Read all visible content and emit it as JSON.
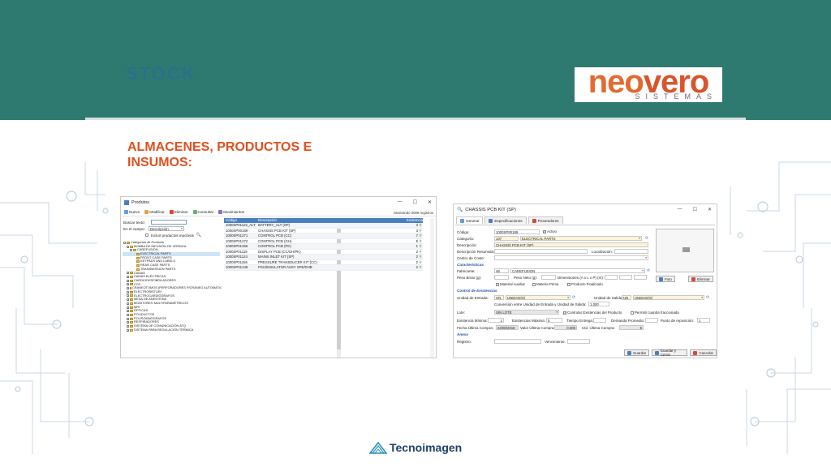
{
  "slide": {
    "title": "STOCK",
    "section_heading": "ALMACENES, PRODUCTOS E INSUMOS:",
    "logo": {
      "word_part1": "neo",
      "word_part2": "vero",
      "sub": "SISTEMAS"
    },
    "footer_logo": "Tecnoimagen",
    "colors": {
      "band": "#2f7a70",
      "heading": "#e0501f",
      "logo_orange": "#e36a2e"
    }
  },
  "products_window": {
    "title": "Produtos",
    "controls": {
      "minimize": "—",
      "maximize": "☐",
      "close": "✕"
    },
    "toolbar": [
      "Nuevo",
      "Modificar",
      "Eliminar",
      "Consultar",
      "Movimientos"
    ],
    "status": "Mostrando 0009 registros",
    "search": {
      "label": "Buscar texto:",
      "field_label": "En el campo:",
      "field_value": "Descripción",
      "include_inactive": "Incluir productos inactivos"
    },
    "tree": [
      {
        "label": "Categorías de Producto",
        "level": 0,
        "expander": "−"
      },
      {
        "label": "BOMBA DE INFUSIÓN DE JERINGA",
        "level": 1,
        "expander": "−"
      },
      {
        "label": "CAREFUSION",
        "level": 2,
        "expander": "−"
      },
      {
        "label": "ELECTRICAL PARTS",
        "level": 3,
        "expander": "",
        "selected": true
      },
      {
        "label": "FRONT CASE PARTS",
        "level": 3,
        "expander": ""
      },
      {
        "label": "KEYPADS AND LABELS",
        "level": 3,
        "expander": ""
      },
      {
        "label": "REAR CASE PARTS",
        "level": 3,
        "expander": ""
      },
      {
        "label": "TRANSMISSION PARTS",
        "level": 3,
        "expander": ""
      },
      {
        "label": "CAMAS",
        "level": 1,
        "expander": "+"
      },
      {
        "label": "CAMAS ELÉCTRICAS",
        "level": 1,
        "expander": "+"
      },
      {
        "label": "CARDIODESFIBRILADORES",
        "level": 1,
        "expander": "+"
      },
      {
        "label": "CO2",
        "level": 1,
        "expander": "+"
      },
      {
        "label": "CRANEOTOMOS (PERFORADORES P/CRÁNEO AUTOMÁTICOS)",
        "level": 1,
        "expander": "+"
      },
      {
        "label": "ELECTROBISTURI",
        "level": 1,
        "expander": "+"
      },
      {
        "label": "ELECTROCARDIÓGRAFOS",
        "level": 1,
        "expander": "+"
      },
      {
        "label": "MESA DE ANESTESIA",
        "level": 1,
        "expander": "+"
      },
      {
        "label": "MONITORES MULTIPARAMÉTRICOS",
        "level": 1,
        "expander": "+"
      },
      {
        "label": "MRI",
        "level": 1,
        "expander": "+"
      },
      {
        "label": "ÓPTICAS",
        "level": 1,
        "expander": "+"
      },
      {
        "label": "POLIDUCTOS",
        "level": 1,
        "expander": "+"
      },
      {
        "label": "POLISOMNÓGRAFOS",
        "level": 1,
        "expander": "+"
      },
      {
        "label": "RESPIRADORES",
        "level": 1,
        "expander": "+"
      },
      {
        "label": "SISTEMA DE COMUNICACIÓN ATQ",
        "level": 1,
        "expander": "+"
      },
      {
        "label": "SISTEMA PARA REGULACIÓN TÉRMICA",
        "level": 1,
        "expander": "+"
      }
    ],
    "grid": {
      "columns": [
        "Código",
        "Descripción",
        "Existencia"
      ],
      "rows": [
        {
          "code": "1000SP01122_ALT",
          "desc": "BATTERY_ALT (SP)",
          "qty": "3"
        },
        {
          "code": "1000SP00189",
          "desc": "CHASSIS PCB KIT (SP)",
          "qty": "3"
        },
        {
          "code": "1000SP01271",
          "desc": "CONTROL PCB (CC)",
          "qty": "7"
        },
        {
          "code": "1000SP01272",
          "desc": "CONTROL PCB (GH)",
          "qty": "5"
        },
        {
          "code": "1000SP01455",
          "desc": "CONTROL PCB (PK)",
          "qty": "1"
        },
        {
          "code": "1000SP01119",
          "desc": "DISPLAY PCB (CC/GH/PK)",
          "qty": "2"
        },
        {
          "code": "1000SP01124",
          "desc": "MAINS INLET KIT (SP)",
          "qty": "2"
        },
        {
          "code": "1000SP01155",
          "desc": "PRESSURE TRANSDUCER KIT (CC)",
          "qty": "2"
        },
        {
          "code": "1000SP01448",
          "desc": "PSU/INSULATOR ASSY SPE/DHB",
          "qty": "2"
        }
      ]
    }
  },
  "product_form": {
    "title": "CHASSIS PCB KIT (SP)",
    "controls": {
      "minimize": "—",
      "maximize": "☐",
      "close": "✕"
    },
    "tabs": [
      "General",
      "Especificaciones",
      "Proveedores"
    ],
    "fields": {
      "codigo_label": "Código:",
      "codigo": "1000SP00189",
      "activo": "Activo",
      "categoria_label": "Categoría:",
      "categoria_code": "137",
      "categoria": "ELECTRICAL PARTS",
      "descripcion_label": "Descripción:",
      "descripcion": "CHASSIS PCB KIT (SP)",
      "desc_resumida_label": "Descripción Resumida:",
      "localizacion_label": "Localización:",
      "centro_coste_label": "Centro de Coste:",
      "caracteristicas": "Características",
      "fabricante_label": "Fabricante:",
      "fabricante_code": "48",
      "fabricante": "CAREFUSION",
      "peso_bruto_label": "Peso Bruto (g):",
      "peso_neto_label": "Peso Neto (g):",
      "dimensiones_label": "Dimensiones (A x L x P) (m):",
      "material_auxiliar": "Material Auxiliar",
      "materia_prima": "Materia Prima",
      "producto_finalizado": "Producto Finalizado",
      "control_existencias": "Control de Existencias",
      "unidad_entrada_label": "Unidad de Entrada:",
      "unidad_entrada_code": "UN",
      "unidad_entrada": "UNIDAD(S)",
      "unidad_salida_label": "Unidad de Salida:",
      "unidad_salida_code": "UN",
      "unidad_salida": "UNIDAD(S)",
      "conversion_label": "Conversión entre Unidad de Entrada y Unidad de Salida:",
      "conversion": "1,000",
      "lote_label": "Lote:",
      "lote": "SIN LOTE",
      "controlar_existencias": "Controlar Existencias del Producto",
      "permitir_fraccionada": "Permitir cuantía fraccionada",
      "exist_minima_label": "Existencia Mínima:",
      "exist_minima": "1",
      "exist_maxima_label": "Existencias Máxima:",
      "exist_maxima": "5",
      "tiempo_entrega_label": "Tiempo Entrega:",
      "demanda_label": "Demanda Promedio:",
      "punto_repos_label": "Punto de reposición:",
      "punto_repos": "1",
      "fecha_ultima_label": "Fecha Última Compra:",
      "fecha_ultima": "23/08/2018",
      "valor_ultima_label": "Valor Última Compra:",
      "valor_ultima": "0,000",
      "ctd_ultima_label": "Ctd. Última Compra:",
      "ctd_ultima": "5",
      "anexo": "Anexo",
      "registro_label": "Registro:",
      "vencimiento_label": "Vencimiento:"
    },
    "photo_buttons": {
      "foto": "Foto",
      "eliminar": "Eliminar"
    },
    "buttons": {
      "guardar": "Guardar",
      "guardar_cerrar": "Guardar y Cerrar",
      "cancelar": "Cancelar"
    }
  }
}
